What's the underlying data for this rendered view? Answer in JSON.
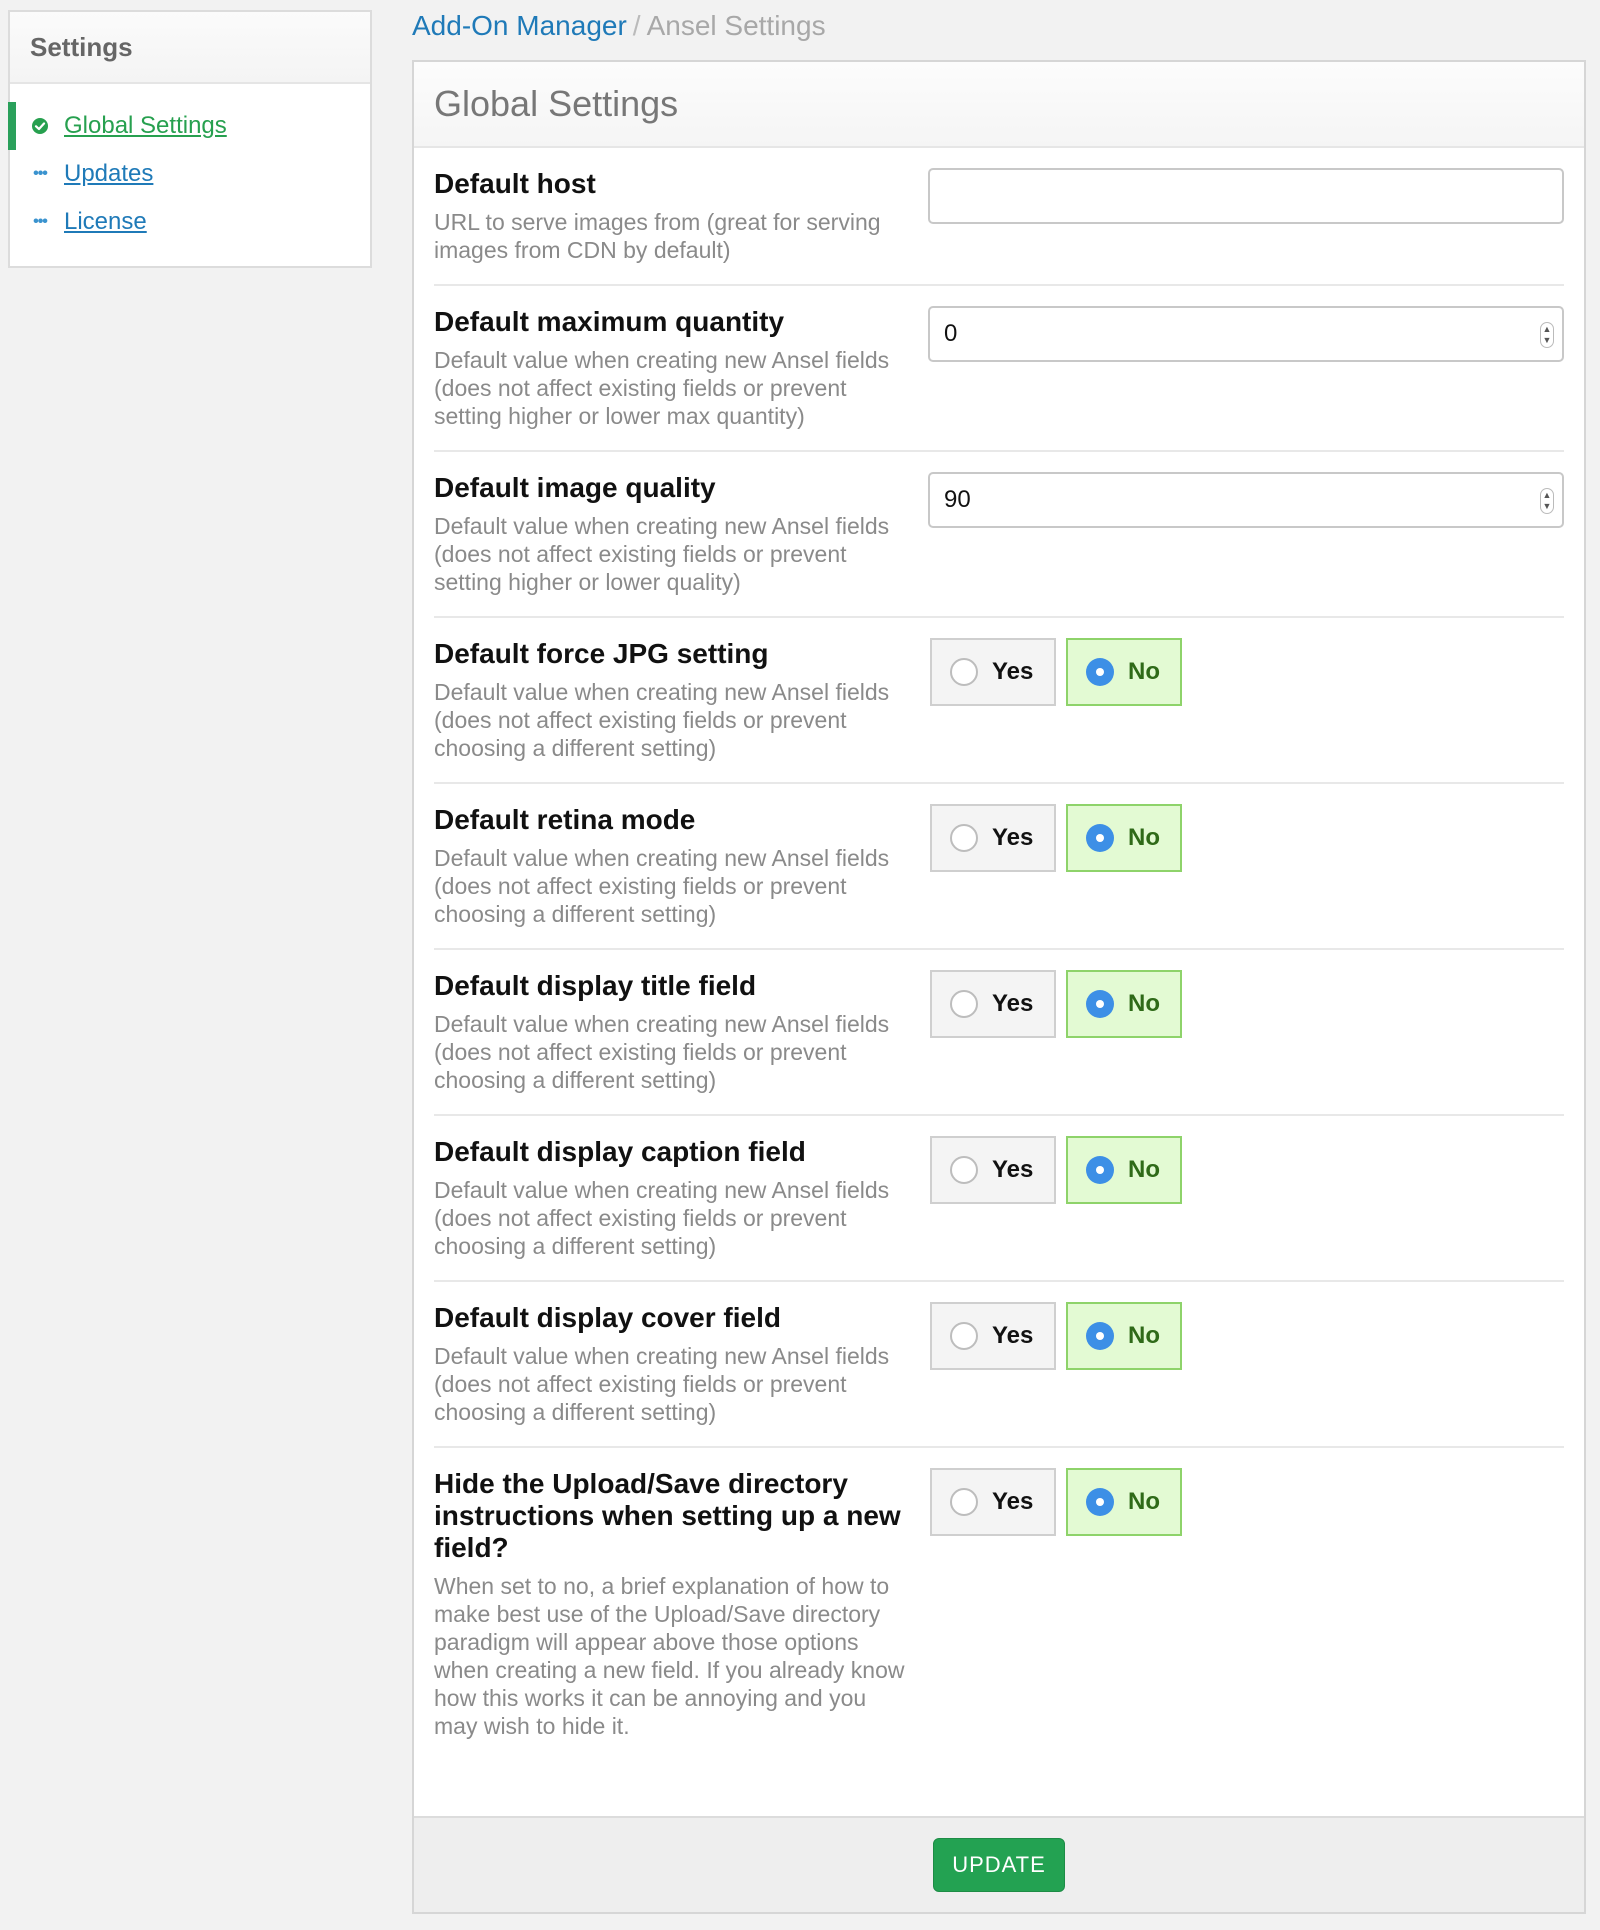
{
  "sidebar": {
    "title": "Settings",
    "items": [
      {
        "label": "Global Settings",
        "icon": "check-circle-icon"
      },
      {
        "label": "Updates",
        "icon": "dots-icon"
      },
      {
        "label": "License",
        "icon": "dots-icon"
      }
    ]
  },
  "breadcrumb": {
    "parent": "Add-On Manager",
    "separator": "/",
    "current": "Ansel Settings"
  },
  "panel": {
    "title": "Global Settings"
  },
  "settings": [
    {
      "title": "Default host",
      "description": "URL to serve images from (great for serving images from CDN by default)",
      "value": ""
    },
    {
      "title": "Default maximum quantity",
      "description": "Default value when creating new Ansel fields (does not affect existing fields or prevent setting higher or lower max quantity)",
      "value": "0"
    },
    {
      "title": "Default image quality",
      "description": "Default value when creating new Ansel fields (does not affect existing fields or prevent setting higher or lower quality)",
      "value": "90"
    },
    {
      "title": "Default force JPG setting",
      "description": "Default value when creating new Ansel fields (does not affect existing fields or prevent choosing a different setting)",
      "selected": "No"
    },
    {
      "title": "Default retina mode",
      "description": "Default value when creating new Ansel fields (does not affect existing fields or prevent choosing a different setting)",
      "selected": "No"
    },
    {
      "title": "Default display title field",
      "description": "Default value when creating new Ansel fields (does not affect existing fields or prevent choosing a different setting)",
      "selected": "No"
    },
    {
      "title": "Default display caption field",
      "description": "Default value when creating new Ansel fields (does not affect existing fields or prevent choosing a different setting)",
      "selected": "No"
    },
    {
      "title": "Default display cover field",
      "description": "Default value when creating new Ansel fields (does not affect existing fields or prevent choosing a different setting)",
      "selected": "No"
    },
    {
      "title": "Hide the Upload/Save directory instructions when setting up a new field?",
      "description": "When set to no, a brief explanation of how to make best use of the Upload/Save directory paradigm will appear above those options when creating a new field. If you already know how this works it can be annoying and you may wish to hide it.",
      "selected": "No"
    }
  ],
  "radio_labels": {
    "yes": "Yes",
    "no": "No"
  },
  "footer": {
    "update_label": "UPDATE"
  },
  "colors": {
    "accent_green": "#23a252",
    "link_blue": "#1f7ab8",
    "selected_bg": "#e3fad3",
    "radio_blue": "#3d8fe6"
  }
}
